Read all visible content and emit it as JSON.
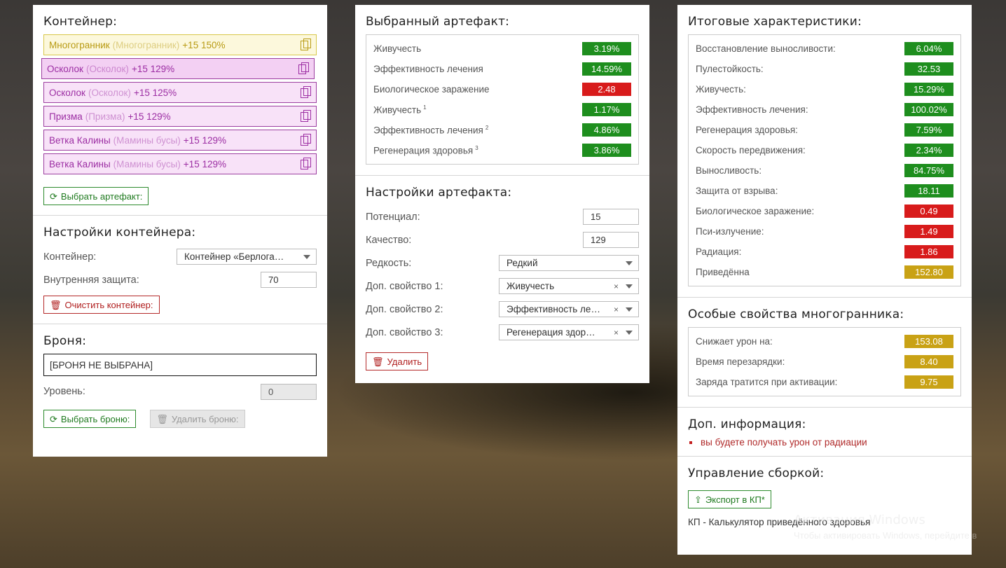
{
  "container": {
    "title": "Контейнер:",
    "slots": [
      {
        "name": "Многогранник",
        "alt": "(Многогранник)",
        "level": "+15 150%"
      },
      {
        "name": "Осколок",
        "alt": "(Осколок)",
        "level": "+15 129%"
      },
      {
        "name": "Осколок",
        "alt": "(Осколок)",
        "level": "+15 125%"
      },
      {
        "name": "Призма",
        "alt": "(Призма)",
        "level": "+15 129%"
      },
      {
        "name": "Ветка Калины",
        "alt": "(Мамины бусы)",
        "level": "+15 129%"
      },
      {
        "name": "Ветка Калины",
        "alt": "(Мамины бусы)",
        "level": "+15 129%"
      }
    ],
    "select_button": "Выбрать артефакт:"
  },
  "container_settings": {
    "title": "Настройки контейнера:",
    "container_label": "Контейнер:",
    "container_value": "Контейнер «Берлога…",
    "protection_label": "Внутренняя защита:",
    "protection_value": "70",
    "clear_button": "Очистить контейнер:"
  },
  "armor": {
    "title": "Броня:",
    "value": "[БРОНЯ НЕ ВЫБРАНА]",
    "level_label": "Уровень:",
    "level_value": "0",
    "select_button": "Выбрать броню:",
    "delete_button": "Удалить броню:"
  },
  "selected_artifact": {
    "title": "Выбранный артефакт:",
    "stats": [
      {
        "label": "Живучесть",
        "sup": "",
        "value": "3.19%",
        "color": "green"
      },
      {
        "label": "Эффективность лечения",
        "sup": "",
        "value": "14.59%",
        "color": "green"
      },
      {
        "label": "Биологическое заражение",
        "sup": "",
        "value": "2.48",
        "color": "red"
      },
      {
        "label": "Живучесть",
        "sup": "1",
        "value": "1.17%",
        "color": "green"
      },
      {
        "label": "Эффективность лечения",
        "sup": "2",
        "value": "4.86%",
        "color": "green"
      },
      {
        "label": "Регенерация здоровья",
        "sup": "3",
        "value": "3.86%",
        "color": "green"
      }
    ]
  },
  "artifact_settings": {
    "title": "Настройки артефакта:",
    "potential_label": "Потенциал:",
    "potential_value": "15",
    "quality_label": "Качество:",
    "quality_value": "129",
    "rarity_label": "Редкость:",
    "rarity_value": "Редкий",
    "prop1_label": "Доп. свойство 1:",
    "prop1_value": "Живучесть",
    "prop2_label": "Доп. свойство 2:",
    "prop2_value": "Эффективность ле…",
    "prop3_label": "Доп. свойство 3:",
    "prop3_value": "Регенерация здор…",
    "clear_symbol": "×",
    "delete_button": "Удалить"
  },
  "totals": {
    "title": "Итоговые характеристики:",
    "stats": [
      {
        "label": "Восстановление выносливости:",
        "value": "6.04%",
        "color": "green"
      },
      {
        "label": "Пулестойкость:",
        "value": "32.53",
        "color": "green"
      },
      {
        "label": "Живучесть:",
        "value": "15.29%",
        "color": "green"
      },
      {
        "label": "Эффективность лечения:",
        "value": "100.02%",
        "color": "green"
      },
      {
        "label": "Регенерация здоровья:",
        "value": "7.59%",
        "color": "green"
      },
      {
        "label": "Скорость передвижения:",
        "value": "2.34%",
        "color": "green"
      },
      {
        "label": "Выносливость:",
        "value": "84.75%",
        "color": "green"
      },
      {
        "label": "Защита от взрыва:",
        "value": "18.11",
        "color": "green"
      },
      {
        "label": "Биологическое заражение:",
        "value": "0.49",
        "color": "red"
      },
      {
        "label": "Пси-излучение:",
        "value": "1.49",
        "color": "red"
      },
      {
        "label": "Радиация:",
        "value": "1.86",
        "color": "red"
      },
      {
        "label": "Приведённа",
        "value": "152.80",
        "color": "yellow"
      }
    ]
  },
  "special": {
    "title": "Особые свойства многогранника:",
    "stats": [
      {
        "label": "Снижает урон на:",
        "value": "153.08",
        "color": "yellow"
      },
      {
        "label": "Время перезарядки:",
        "value": "8.40",
        "color": "yellow"
      },
      {
        "label": "Заряда тратится при активации:",
        "value": "9.75",
        "color": "yellow"
      }
    ]
  },
  "extra_info": {
    "title": "Доп. информация:",
    "items": [
      "вы будете получать урон от радиации"
    ]
  },
  "build": {
    "title": "Управление сборкой:",
    "export_button": "Экспорт в КП*",
    "footnote": "КП - Калькулятор приведённого здоровья"
  },
  "watermark": {
    "line1": "Активация Windows",
    "line2": "Чтобы активировать Windows, перейдите в"
  },
  "colors": {
    "green": "#1e8e1e",
    "red": "#d81b1b",
    "yellow": "#c9a215"
  }
}
